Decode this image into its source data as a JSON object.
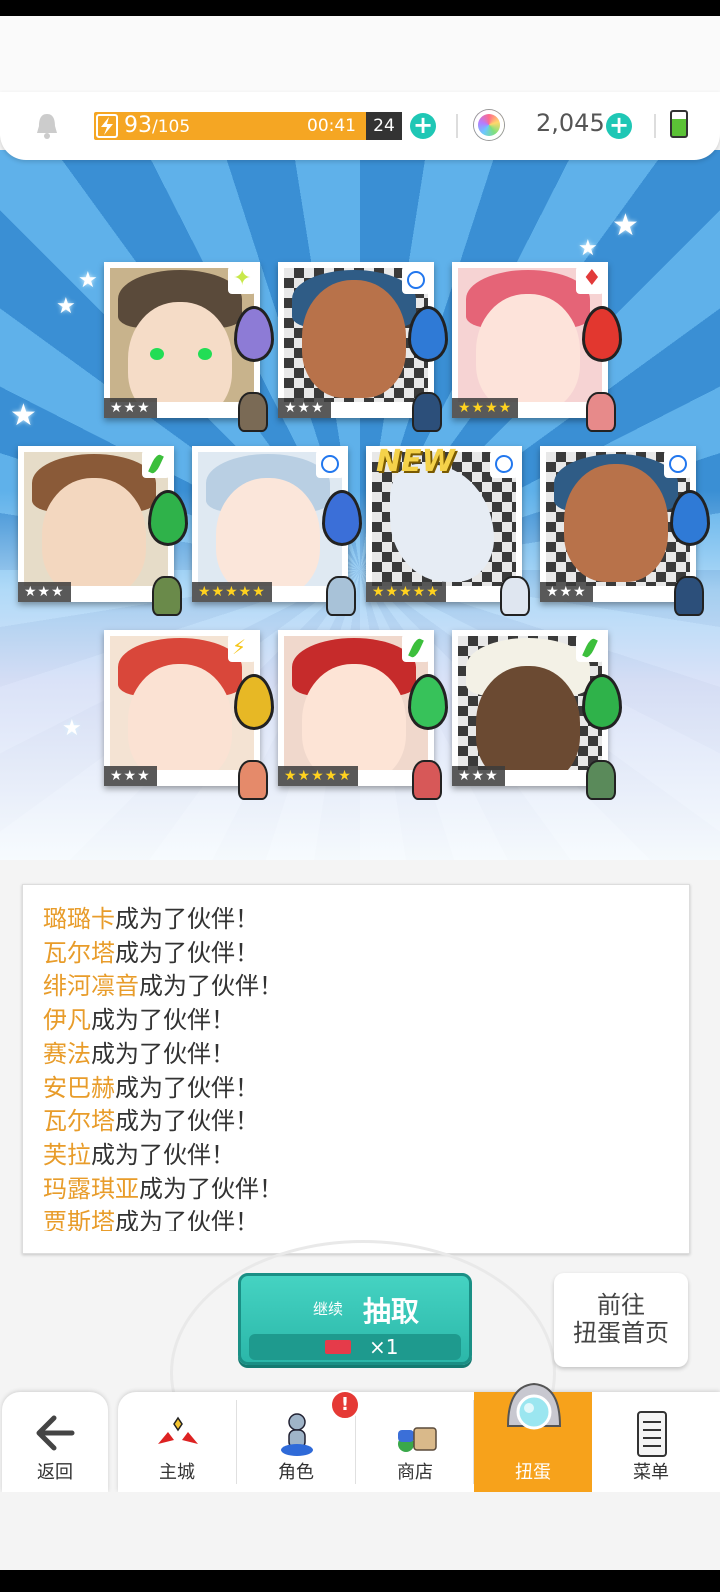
{
  "hud": {
    "stamina_current": "93",
    "stamina_max": "/105",
    "timer_main": "00:41",
    "timer_box": "24",
    "gems": "2,045",
    "stamina_fraction": 0.886,
    "icons": [
      "bell-icon",
      "stamina-bolt-icon",
      "gem-icon",
      "battery-icon",
      "plus-icon"
    ]
  },
  "cards": [
    {
      "rarity": "★★★",
      "element": "light",
      "new": false
    },
    {
      "rarity": "★★★",
      "element": "water",
      "new": false
    },
    {
      "rarity": "★★★★",
      "element": "fire",
      "new": false
    },
    {
      "rarity": "★★★",
      "element": "wind",
      "new": false
    },
    {
      "rarity": "★★★★★",
      "element": "water",
      "new": false
    },
    {
      "rarity": "★★★★★",
      "element": "water",
      "new": true
    },
    {
      "rarity": "★★★",
      "element": "water",
      "new": false
    },
    {
      "rarity": "★★★",
      "element": "thunder",
      "new": false
    },
    {
      "rarity": "★★★★★",
      "element": "wind",
      "new": false
    },
    {
      "rarity": "★★★",
      "element": "wind",
      "new": false
    }
  ],
  "new_label": "NEW",
  "log": {
    "suffix": "成为了伙伴！",
    "names": [
      "璐璐卡",
      "瓦尔塔",
      "绯河凛音",
      "伊凡",
      "赛法",
      "安巴赫",
      "瓦尔塔",
      "芙拉",
      "玛露琪亚",
      "贾斯塔"
    ]
  },
  "actions": {
    "draw_prefix": "继续",
    "draw_label": "抽取",
    "draw_cost": "×1",
    "go_home_line1": "前往",
    "go_home_line2": "扭蛋首页"
  },
  "nav": {
    "back": "返回",
    "items": [
      "主城",
      "角色",
      "商店",
      "扭蛋",
      "菜单"
    ],
    "active_index": 3,
    "badge": "!"
  },
  "colors": {
    "accent": "#f7a21b",
    "teal": "#2bb7a9",
    "name_orange": "#e89c2a",
    "stamina": "#f5a623"
  }
}
